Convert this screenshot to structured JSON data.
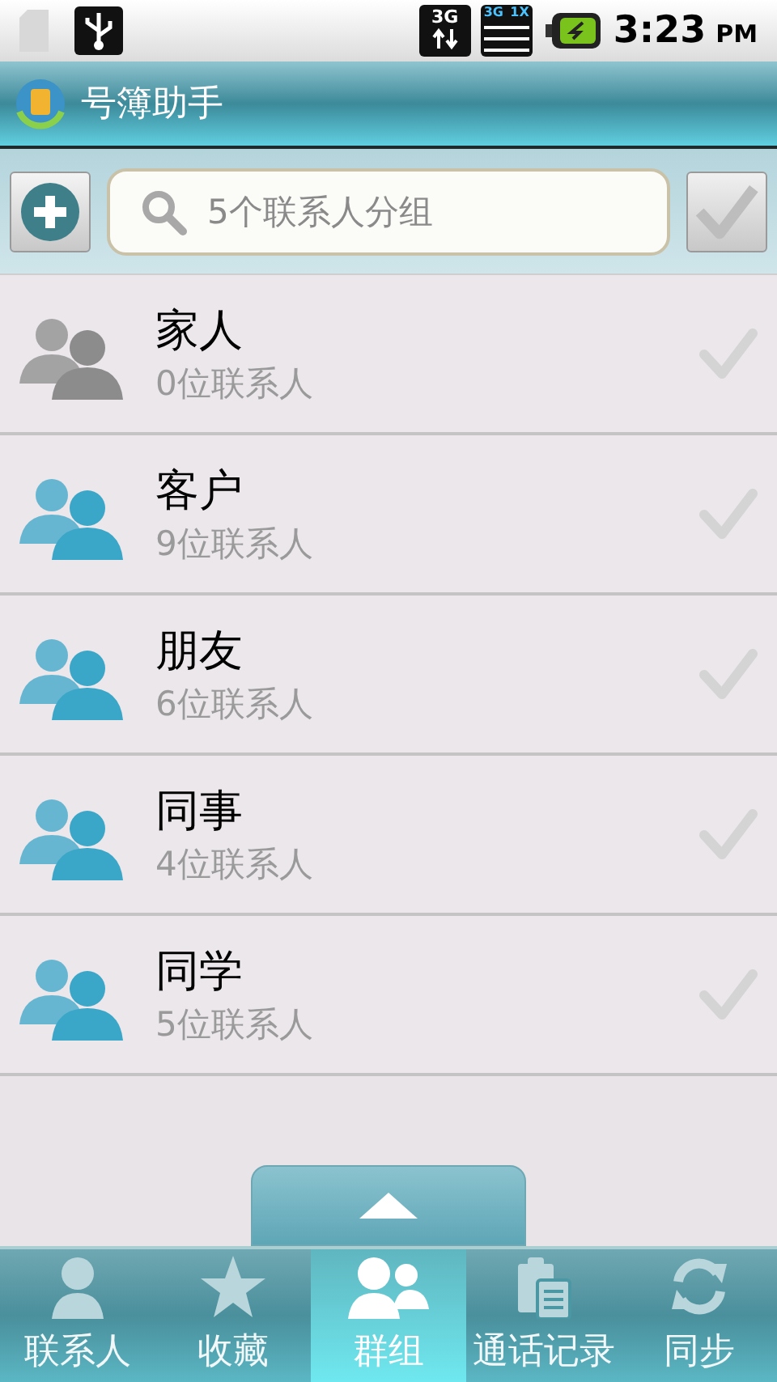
{
  "status_bar": {
    "network": "3G",
    "signal_labels": [
      "3G",
      "1X"
    ],
    "time": "3:23",
    "ampm": "PM"
  },
  "title_bar": {
    "title": "号簿助手"
  },
  "toolbar": {
    "search": {
      "placeholder": "5个联系人分组"
    }
  },
  "groups": [
    {
      "name": "家人",
      "count": "0位联系人",
      "color": "#8c8c8c",
      "checked": false
    },
    {
      "name": "客户",
      "count": "9位联系人",
      "color": "#3aa6c8",
      "checked": false
    },
    {
      "name": "朋友",
      "count": "6位联系人",
      "color": "#3aa6c8",
      "checked": false
    },
    {
      "name": "同事",
      "count": "4位联系人",
      "color": "#3aa6c8",
      "checked": false
    },
    {
      "name": "同学",
      "count": "5位联系人",
      "color": "#3aa6c8",
      "checked": false
    }
  ],
  "tabs": [
    {
      "kind": "person",
      "label": "联系人",
      "selected": false
    },
    {
      "kind": "star",
      "label": "收藏",
      "selected": false
    },
    {
      "kind": "group",
      "label": "群组",
      "selected": true
    },
    {
      "kind": "log",
      "label": "通话记录",
      "selected": false
    },
    {
      "kind": "sync",
      "label": "同步",
      "selected": false
    }
  ]
}
